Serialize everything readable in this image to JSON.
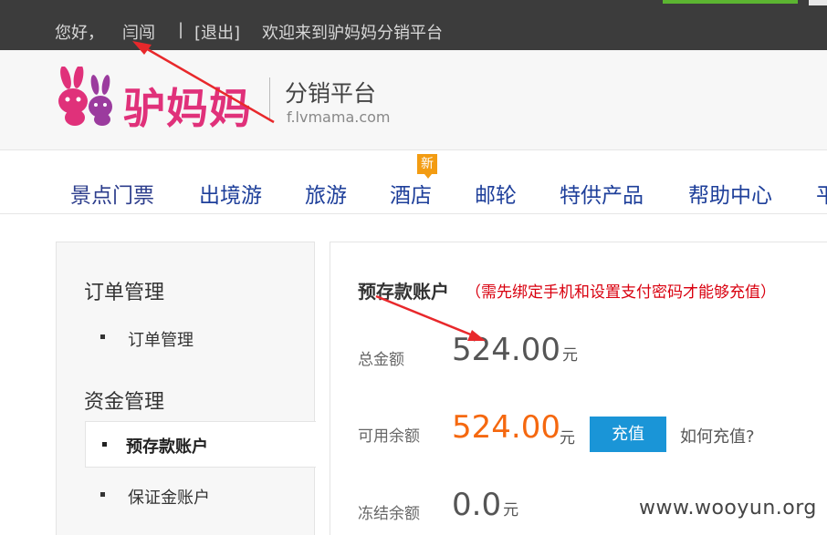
{
  "topbar": {
    "greeting": "您好，",
    "username": "闫闯",
    "separator": "|",
    "logout": "[退出]",
    "welcome": "欢迎来到驴妈妈分销平台"
  },
  "logo": {
    "brand": "驴妈妈",
    "subtitle": "分销平台",
    "url": "f.lvmama.com"
  },
  "nav": {
    "items": [
      "景点门票",
      "出境游",
      "旅游",
      "酒店",
      "邮轮",
      "特供产品",
      "帮助中心",
      "平"
    ],
    "new_badge": "新"
  },
  "sidebar": {
    "orders_heading": "订单管理",
    "orders_item": "订单管理",
    "funds_heading": "资金管理",
    "prepaid_item": "预存款账户",
    "deposit_item": "保证金账户"
  },
  "account": {
    "title": "预存款账户",
    "note": "（需先绑定手机和设置支付密码才能够充值）",
    "total_label": "总金额",
    "total_value": "524.00",
    "available_label": "可用余额",
    "available_value": "524.00",
    "frozen_label": "冻结余额",
    "frozen_value": "0.0",
    "unit": "元",
    "recharge_button": "充值",
    "how_to": "如何充值?"
  },
  "watermark": "www.wooyun.org",
  "colors": {
    "brand_pink": "#e0317a",
    "nav_blue": "#1e3f9a",
    "available_orange": "#f5680f",
    "button_blue": "#1a95d7",
    "note_red": "#d9000f",
    "arrow_red": "#e8282b"
  }
}
